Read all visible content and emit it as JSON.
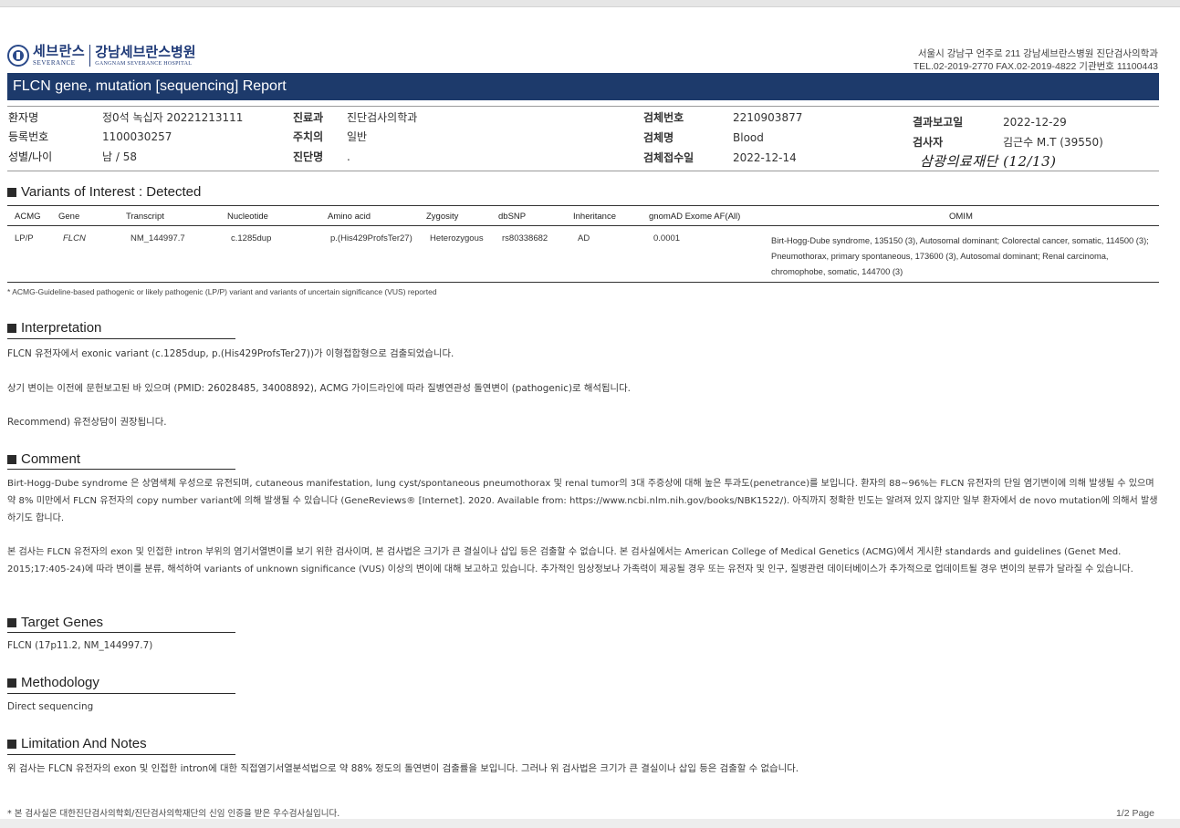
{
  "header": {
    "logo_ko_a": "세브란스",
    "logo_en_a": "SEVERANCE",
    "logo_ko_b": "강남세브란스병원",
    "logo_en_b": "GANGNAM SEVERANCE HOSPITAL",
    "address_line1": "서울시 강남구 언주로 211 강남세브란스병원 진단검사의학과",
    "address_line2": "TEL.02-2019-2770 FAX.02-2019-4822 기관번호 11100443",
    "report_title": "FLCN gene, mutation [sequencing] Report"
  },
  "patient": {
    "name_label": "환자명",
    "name_value": "정0석 녹십자 20221213111",
    "reg_label": "등록번호",
    "reg_value": "1100030257",
    "sexage_label": "성별/나이",
    "sexage_value": "남 / 58",
    "dept_label": "진료과",
    "dept_value": "진단검사의학과",
    "doctor_label": "주치의",
    "doctor_value": "일반",
    "diag_label": "진단명",
    "diag_value": ".",
    "specno_label": "검체번호",
    "specno_value": "2210903877",
    "spec_label": "검체명",
    "spec_value": "Blood",
    "recv_label": "검체접수일",
    "recv_value": "2022-12-14",
    "result_label": "결과보고일",
    "result_value": "2022-12-29",
    "examiner_label": "검사자",
    "examiner_value": "김근수 M.T (39550)",
    "handwritten": "삼광의료재단 (12/13)"
  },
  "variants": {
    "heading": "Variants of Interest  :  Detected",
    "columns": [
      "ACMG",
      "Gene",
      "Transcript",
      "Nucleotide",
      "Amino acid",
      "Zygosity",
      "dbSNP",
      "Inheritance",
      "gnomAD Exome AF(All)",
      "OMIM"
    ],
    "row": {
      "acmg": "LP/P",
      "gene": "FLCN",
      "transcript": "NM_144997.7",
      "nucleotide": "c.1285dup",
      "amino_acid": "p.(His429ProfsTer27)",
      "zygosity": "Heterozygous",
      "dbsnp": "rs80338682",
      "inheritance": "AD",
      "gnomad": "0.0001",
      "omim": "Birt-Hogg-Dube syndrome, 135150 (3), Autosomal dominant; Colorectal cancer, somatic, 114500 (3); Pneumothorax, primary spontaneous, 173600 (3), Autosomal dominant; Renal carcinoma, chromophobe, somatic, 144700 (3)"
    },
    "footnote": "* ACMG-Guideline-based pathogenic or likely pathogenic (LP/P) variant and variants of uncertain significance (VUS) reported"
  },
  "interpretation": {
    "heading": "Interpretation",
    "p1": "FLCN 유전자에서 exonic variant (c.1285dup, p.(His429ProfsTer27))가 이형접합형으로 검출되었습니다.",
    "p2": "상기 변이는 이전에 문헌보고된 바 있으며 (PMID: 26028485, 34008892), ACMG 가이드라인에 따라 질병연관성 돌연변이 (pathogenic)로 해석됩니다.",
    "p3": "Recommend) 유전상담이 권장됩니다."
  },
  "comment": {
    "heading": "Comment",
    "p1": "Birt-Hogg-Dube syndrome 은 상염색체 우성으로 유전되며, cutaneous manifestation, lung cyst/spontaneous pneumothorax 및 renal tumor의 3대 주증상에 대해 높은 투과도(penetrance)를 보입니다. 환자의 88~96%는 FLCN 유전자의  단일 염기변이에 의해 발생될 수 있으며 약 8% 미만에서 FLCN 유전자의 copy number variant에 의해 발생될 수 있습니다 (GeneReviews® [Internet]. 2020. Available from: https://www.ncbi.nlm.nih.gov/books/NBK1522/). 아직까지 정확한 빈도는 알려져 있지 않지만 일부 환자에서 de novo mutation에 의해서 발생하기도 합니다.",
    "p2": "본 검사는 FLCN 유전자의 exon 및 인접한 intron 부위의 염기서열변이를 보기 위한 검사이며, 본 검사법은 크기가 큰 결실이나 삽입 등은 검출할 수 없습니다. 본 검사실에서는 American College of Medical Genetics (ACMG)에서 게시한 standards and guidelines (Genet Med. 2015;17:405-24)에 따라 변이를 분류, 해석하여 variants of unknown significance (VUS) 이상의 변이에 대해 보고하고 있습니다. 추가적인 임상정보나 가족력이 제공될 경우 또는 유전자 및 인구, 질병관련 데이터베이스가 추가적으로 업데이트될 경우 변이의 분류가 달라질 수 있습니다."
  },
  "target": {
    "heading": "Target Genes",
    "text": "FLCN (17p11.2, NM_144997.7)"
  },
  "method": {
    "heading": "Methodology",
    "text": "Direct sequencing"
  },
  "limitation": {
    "heading": "Limitation And Notes",
    "text": "위 검사는 FLCN 유전자의  exon 및 인접한 intron에 대한 직접염기서열분석법으로 약 88% 정도의 돌연변이 검출률을 보입니다. 그러나 위 검사법은 크기가 큰 결실이나 삽입 등은 검출할 수 없습니다."
  },
  "footer": {
    "note": "* 본 검사실은 대한진단검사의학회/진단검사의학재단의 신임 인증을 받은 우수검사실입니다.",
    "page": "1/2 Page"
  }
}
